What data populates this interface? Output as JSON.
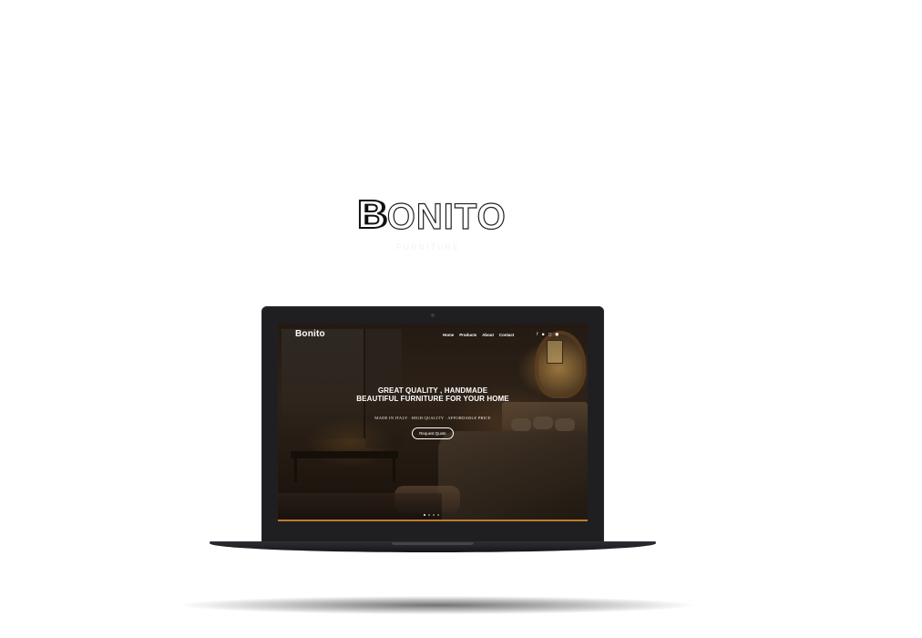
{
  "brand": {
    "logo_first_letter": "B",
    "logo_rest": "ONITO",
    "tagline": "FURNITURE"
  },
  "website": {
    "logo": "Bonito",
    "nav": {
      "items": [
        "Home",
        "Products",
        "About",
        "Contact"
      ]
    },
    "social_icons": [
      "facebook-icon",
      "twitter-icon",
      "instagram-icon",
      "pinterest-icon"
    ],
    "hero": {
      "line1": "GREAT QUALITY , HANDMADE",
      "line2": "BEAUTIFUL FURNITURE FOR YOUR HOME",
      "subtitle": "MADE IN ITALY · HIGH QUALITY · AFFORDABLE PRICE",
      "cta": "Request Quote"
    },
    "slider": {
      "count": 4,
      "active": 1
    }
  },
  "colors": {
    "accent": "#c07a2c",
    "laptop_body": "#1f1f22",
    "background": "#ffffff"
  }
}
